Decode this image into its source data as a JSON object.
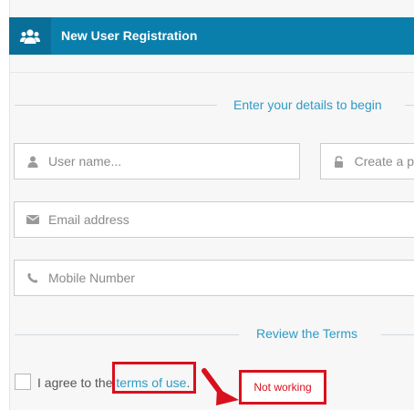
{
  "header": {
    "title": "New User Registration",
    "icon": "users-icon"
  },
  "sections": {
    "details_title": "Enter your details to begin",
    "terms_title": "Review the Terms"
  },
  "fields": {
    "username_placeholder": "User name...",
    "password_placeholder": "Create a p",
    "email_placeholder": "Email address",
    "mobile_placeholder": "Mobile Number"
  },
  "terms": {
    "prefix": "I agree to the ",
    "link": "terms of use",
    "suffix": "."
  },
  "annotation": {
    "note": "Not working"
  },
  "colors": {
    "header_bg": "#0b7fac",
    "accent": "#2e9bc6",
    "annotation_red": "#d8111d"
  }
}
